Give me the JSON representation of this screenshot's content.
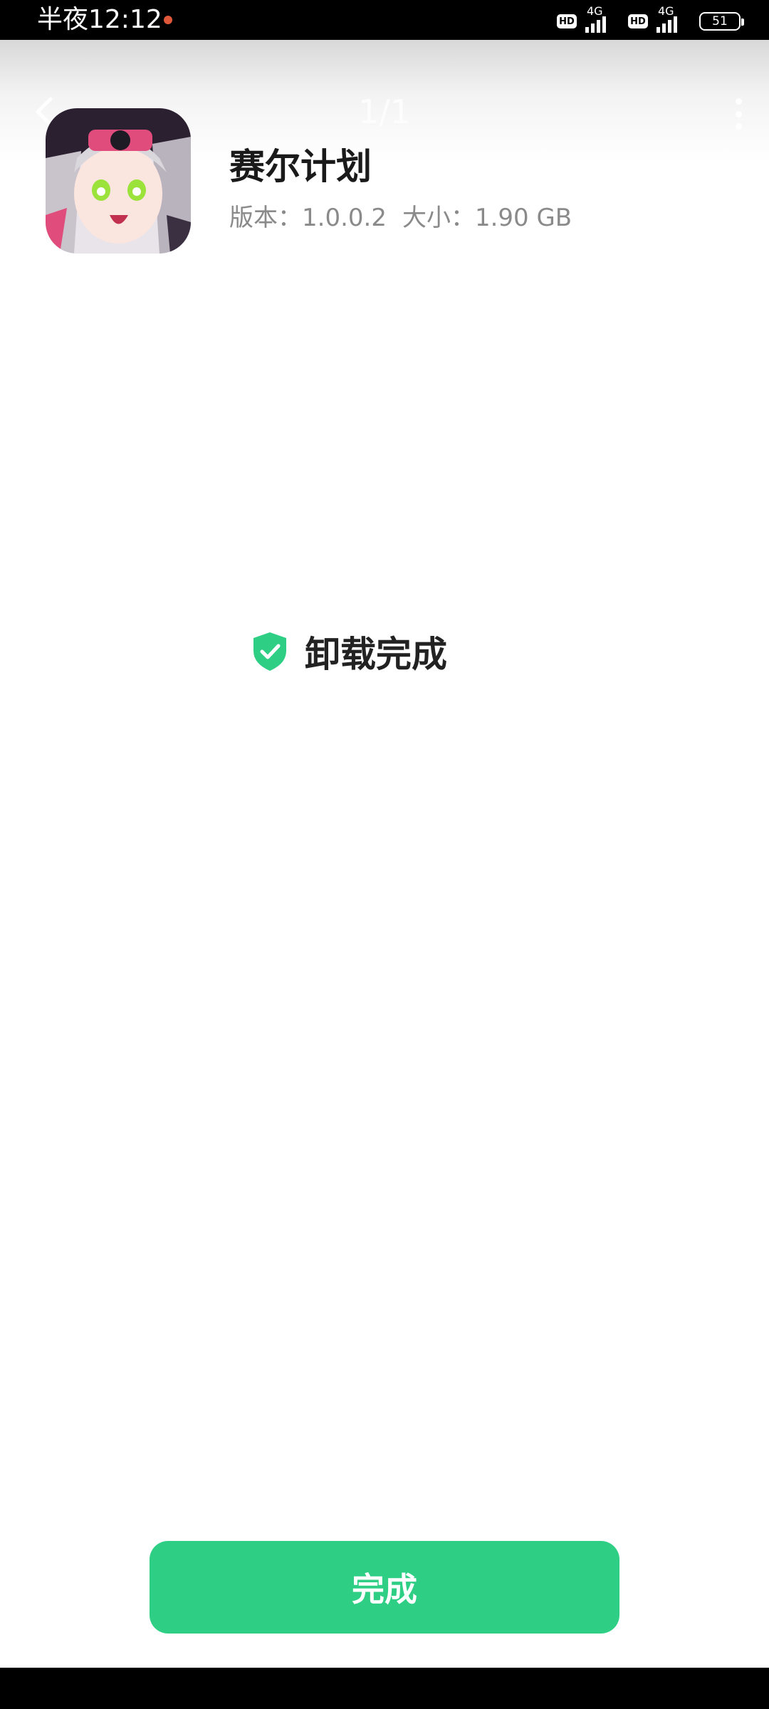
{
  "status_bar": {
    "time": "半夜12:12",
    "sim1_network": "4G",
    "sim2_network": "4G",
    "hd_label": "HD",
    "battery": "51"
  },
  "header": {
    "page_indicator": "1/1"
  },
  "app": {
    "name": "赛尔计划",
    "version": "版本：1.0.0.2",
    "size": "大小：1.90 GB"
  },
  "result": {
    "message": "卸载完成",
    "icon": "shield-check-icon",
    "icon_color": "#2ecf85"
  },
  "actions": {
    "done_label": "完成",
    "done_color": "#2ecf85"
  }
}
